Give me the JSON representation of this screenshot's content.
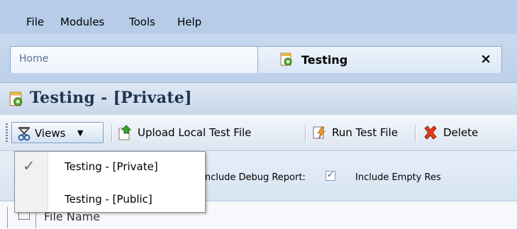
{
  "menu": {
    "items": [
      "File",
      "Modules",
      "Tools",
      "Help"
    ]
  },
  "tabs": [
    {
      "label": "Home"
    },
    {
      "label": "Testing",
      "close": "×"
    }
  ],
  "title": "Testing - [Private]",
  "toolbar": {
    "views_label": "Views",
    "upload_label": "Upload Local Test File",
    "run_label": "Run Test File",
    "delete_label": "Delete"
  },
  "options": {
    "debug_label": "Include Debug Report:",
    "debug_checked": true,
    "empty_label": "Include Empty Res"
  },
  "dropdown": {
    "items": [
      {
        "label": "Testing - [Private]",
        "checked": true
      },
      {
        "label": "Testing - [Public]",
        "checked": false
      }
    ]
  },
  "grid": {
    "column": "File Name"
  },
  "colors": {
    "menubar": "#b6cce8",
    "title_text": "#1f3451",
    "accent": "#7f9dc6"
  },
  "icons": [
    "gear-document-icon",
    "close-icon",
    "views-binoculars-icon",
    "chevron-down-icon",
    "upload-icon",
    "run-icon",
    "delete-icon",
    "check-icon"
  ]
}
